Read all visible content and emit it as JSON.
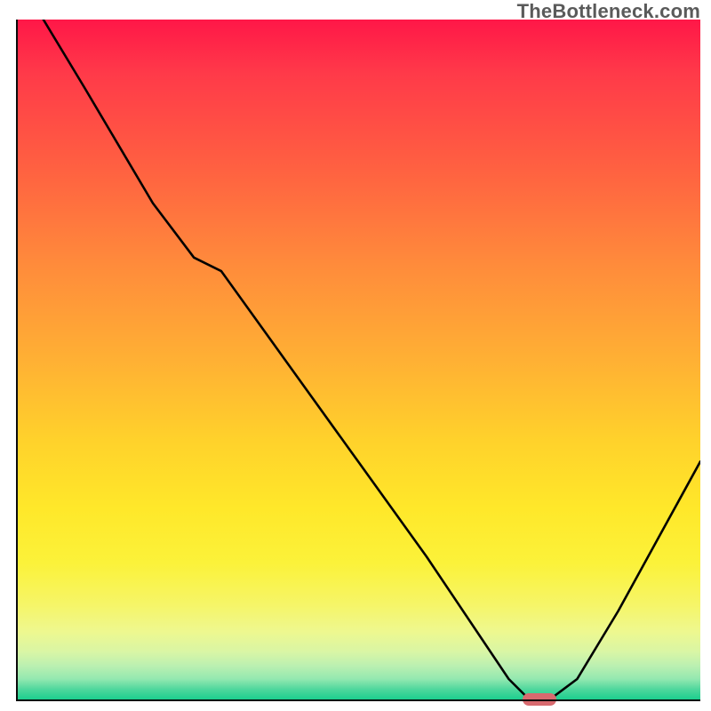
{
  "watermark": "TheBottleneck.com",
  "chart_data": {
    "type": "line",
    "title": "",
    "xlabel": "",
    "ylabel": "",
    "xlim": [
      0,
      100
    ],
    "ylim": [
      0,
      100
    ],
    "grid": false,
    "legend": false,
    "gradient_colors_top_to_bottom": [
      "#ff1748",
      "#ff3a49",
      "#ff6141",
      "#ff8b3b",
      "#ffb034",
      "#ffd22b",
      "#ffe82a",
      "#fbf23a",
      "#f6f567",
      "#eef88f",
      "#d9f6a5",
      "#bcf0b1",
      "#93e8b0",
      "#4fd79d",
      "#1ccf8e"
    ],
    "series": [
      {
        "name": "bottleneck-curve",
        "x": [
          4,
          10,
          20,
          26,
          30,
          40,
          50,
          60,
          68,
          72,
          75,
          78,
          82,
          88,
          94,
          100
        ],
        "y": [
          100,
          90,
          73,
          65,
          63,
          49,
          35,
          21,
          9,
          3,
          0,
          0,
          3,
          13,
          24,
          35
        ]
      }
    ],
    "marker": {
      "x": 76.5,
      "y": 0,
      "color": "#d86a6f"
    },
    "axis_color": "#0a0a0a"
  }
}
